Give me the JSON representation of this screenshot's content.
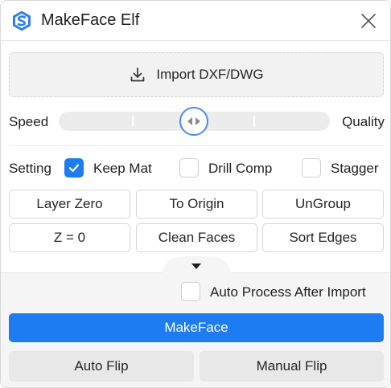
{
  "window": {
    "title": "MakeFace Elf"
  },
  "import": {
    "label": "Import DXF/DWG"
  },
  "slider": {
    "left_label": "Speed",
    "right_label": "Quality",
    "value_fraction": 0.5
  },
  "settings": {
    "label": "Setting",
    "options": [
      {
        "label": "Keep Mat",
        "checked": true
      },
      {
        "label": "Drill Comp",
        "checked": false
      },
      {
        "label": "Stagger",
        "checked": false
      }
    ]
  },
  "actions": {
    "row1": [
      "Layer Zero",
      "To Origin",
      "UnGroup"
    ],
    "row2": [
      "Z = 0",
      "Clean Faces",
      "Sort Edges"
    ]
  },
  "auto_process": {
    "label": "Auto Process After Import",
    "checked": false
  },
  "makeface": {
    "label": "MakeFace"
  },
  "flip": {
    "auto_label": "Auto Flip",
    "manual_label": "Manual Flip"
  },
  "colors": {
    "accent": "#1e7cf2",
    "thumb_border": "#4a8bf5"
  },
  "icons": {
    "app": "makeface-logo-icon",
    "close": "close-icon",
    "import": "download-icon",
    "thumb": "left-right-arrows-icon",
    "collapse": "caret-down-icon",
    "check": "checkmark-icon"
  }
}
